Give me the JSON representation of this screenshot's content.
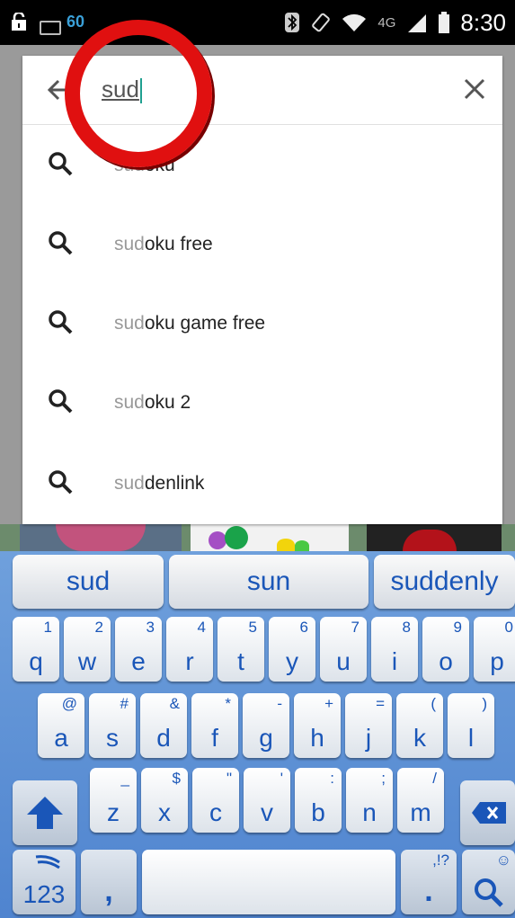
{
  "status_bar": {
    "time": "8:30",
    "network": "4G",
    "notification_text": "60"
  },
  "search": {
    "query": "sud",
    "suggestions": [
      {
        "prefix": "sud",
        "rest": "oku"
      },
      {
        "prefix": "sud",
        "rest": "oku free"
      },
      {
        "prefix": "sud",
        "rest": "oku game free"
      },
      {
        "prefix": "sud",
        "rest": "oku 2"
      },
      {
        "prefix": "sud",
        "rest": "denlink"
      }
    ]
  },
  "keyboard": {
    "predictions": [
      "sud",
      "sun",
      "suddenly"
    ],
    "row1": [
      {
        "key": "q",
        "alt": "1"
      },
      {
        "key": "w",
        "alt": "2"
      },
      {
        "key": "e",
        "alt": "3"
      },
      {
        "key": "r",
        "alt": "4"
      },
      {
        "key": "t",
        "alt": "5"
      },
      {
        "key": "y",
        "alt": "6"
      },
      {
        "key": "u",
        "alt": "7"
      },
      {
        "key": "i",
        "alt": "8"
      },
      {
        "key": "o",
        "alt": "9"
      },
      {
        "key": "p",
        "alt": "0"
      }
    ],
    "row2": [
      {
        "key": "a",
        "alt": "@"
      },
      {
        "key": "s",
        "alt": "#"
      },
      {
        "key": "d",
        "alt": "&"
      },
      {
        "key": "f",
        "alt": "*"
      },
      {
        "key": "g",
        "alt": "-"
      },
      {
        "key": "h",
        "alt": "+"
      },
      {
        "key": "j",
        "alt": "="
      },
      {
        "key": "k",
        "alt": "("
      },
      {
        "key": "l",
        "alt": ")"
      }
    ],
    "row3": [
      {
        "key": "z",
        "alt": "_"
      },
      {
        "key": "x",
        "alt": "$"
      },
      {
        "key": "c",
        "alt": "\""
      },
      {
        "key": "v",
        "alt": "'"
      },
      {
        "key": "b",
        "alt": ":"
      },
      {
        "key": "n",
        "alt": ";"
      },
      {
        "key": "m",
        "alt": "/"
      }
    ],
    "symbols_key": "123",
    "comma_key": ",",
    "period_key": ".",
    "period_alt": ",!?",
    "search_alt": "☺"
  }
}
